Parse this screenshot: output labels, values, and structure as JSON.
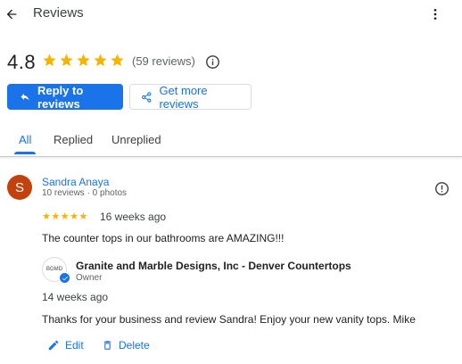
{
  "header": {
    "title": "Reviews",
    "back_icon": "arrow-back-icon",
    "menu_icon": "more-vert-icon"
  },
  "summary": {
    "rating": "4.8",
    "stars": 5,
    "review_count": "(59 reviews)",
    "info_icon": "info-icon",
    "star_color": "#f5b400"
  },
  "actions": {
    "reply_label": "Reply to reviews",
    "get_more_label": "Get more reviews"
  },
  "tabs": [
    {
      "label": "All",
      "active": true
    },
    {
      "label": "Replied",
      "active": false
    },
    {
      "label": "Unreplied",
      "active": false
    }
  ],
  "review": {
    "avatar_letter": "S",
    "avatar_color": "#c2410c",
    "reviewer_name": "Sandra Anaya",
    "reviewer_meta": "10 reviews · 0 photos",
    "stars": "★★★★★",
    "age": "16 weeks ago",
    "text": "The counter tops in our bathrooms are AMAZING!!!",
    "report_icon": "report-flag-icon",
    "owner_reply": {
      "logo_text": "BGMD",
      "business_name": "Granite and Marble Designs, Inc - Denver Countertops",
      "owner_label": "Owner",
      "age": "14 weeks ago",
      "text": "Thanks for your business and review Sandra! Enjoy your new vanity tops. Mike"
    },
    "edit_label": "Edit",
    "delete_label": "Delete"
  },
  "colors": {
    "accent": "#1a73e8",
    "text": "#202124"
  }
}
